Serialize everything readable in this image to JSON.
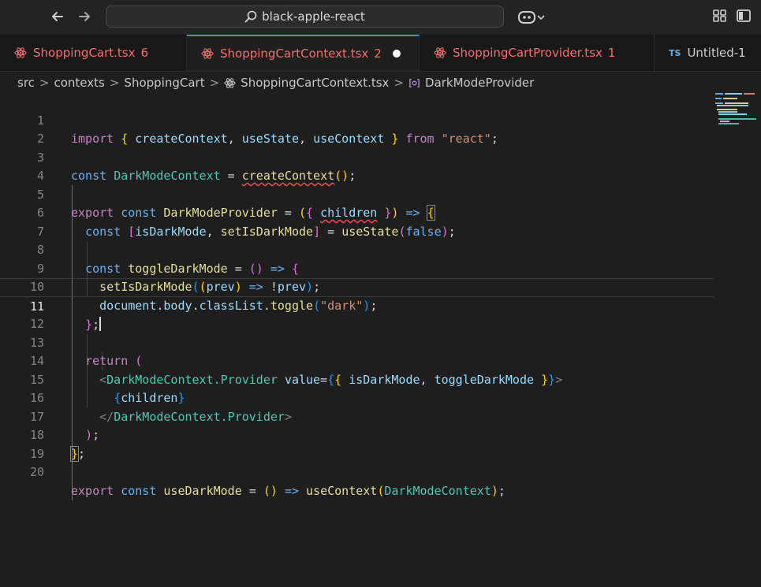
{
  "titlebar": {
    "back_icon": "arrow-left-icon",
    "forward_icon": "arrow-right-icon",
    "search_text": "black-apple-react",
    "copilot_icon": "copilot-icon"
  },
  "tabs": [
    {
      "label": "ShoppingCart.tsx",
      "count": "6",
      "icon": "react-icon",
      "active": false
    },
    {
      "label": "ShoppingCartContext.tsx",
      "count": "2",
      "icon": "react-icon",
      "active": true,
      "dirty": true
    },
    {
      "label": "ShoppingCartProvider.tsx",
      "count": "1",
      "icon": "react-icon",
      "active": false
    },
    {
      "label": "Untitled-1",
      "badge": "TS",
      "active": false
    }
  ],
  "breadcrumb": {
    "items": [
      "src",
      "contexts",
      "ShoppingCart",
      "ShoppingCartContext.tsx",
      "DarkModeProvider"
    ],
    "separator": ">"
  },
  "editor": {
    "current_line": 11,
    "line_numbers": [
      "1",
      "2",
      "3",
      "4",
      "5",
      "6",
      "7",
      "8",
      "9",
      "10",
      "11",
      "12",
      "13",
      "14",
      "15",
      "16",
      "17",
      "18",
      "19",
      "20"
    ],
    "lines": [
      "import { createContext, useState, useContext } from \"react\";",
      "",
      "const DarkModeContext = createContext();",
      "",
      "export const DarkModeProvider = ({ children }) => {",
      "  const [isDarkMode, setIsDarkMode] = useState(false);",
      "",
      "  const toggleDarkMode = () => {",
      "    setIsDarkMode((prev) => !prev);",
      "    document.body.classList.toggle(\"dark\");",
      "  };",
      "",
      "  return (",
      "    <DarkModeContext.Provider value={{ isDarkMode, toggleDarkMode }}>",
      "      {children}",
      "    </DarkModeContext.Provider>",
      "  );",
      "};",
      "",
      "export const useDarkMode = () => useContext(DarkModeContext);"
    ]
  },
  "colors": {
    "keyword": "#6db3f2",
    "function": "#e6df9a",
    "variable": "#9cdcfe",
    "string": "#ce9178",
    "error": "#f07070",
    "accent": "#3e8fe0"
  }
}
